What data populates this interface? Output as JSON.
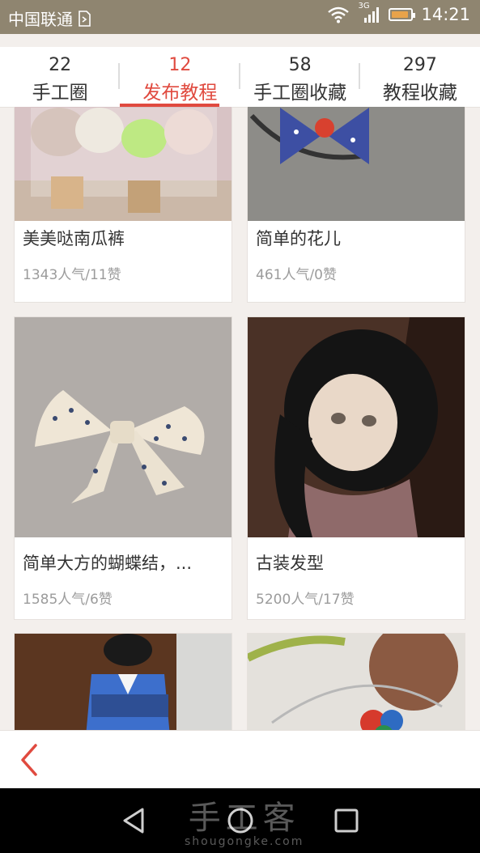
{
  "status_bar": {
    "carrier": "中国联通",
    "network_label": "3G",
    "time": "14:21"
  },
  "tabs": [
    {
      "count": "22",
      "label": "手工圈"
    },
    {
      "count": "12",
      "label": "发布教程"
    },
    {
      "count": "58",
      "label": "手工圈收藏"
    },
    {
      "count": "297",
      "label": "教程收藏"
    }
  ],
  "cards": [
    {
      "title": "美美哒南瓜裤",
      "stats": "1343人气/11赞"
    },
    {
      "title": "简单的花儿",
      "stats": "461人气/0赞"
    },
    {
      "title": "简单大方的蝴蝶结，...",
      "stats": "1585人气/6赞"
    },
    {
      "title": "古装发型",
      "stats": "5200人气/17赞"
    }
  ],
  "watermark": {
    "text": "手工客",
    "url": "shougongke.com"
  },
  "colors": {
    "accent": "#e04a3f",
    "status_bar": "#8f8570"
  },
  "icons": {
    "back": "chevron-left-icon",
    "nav_back": "triangle-back-icon",
    "nav_home": "circle-home-icon",
    "nav_recent": "square-recent-icon"
  }
}
